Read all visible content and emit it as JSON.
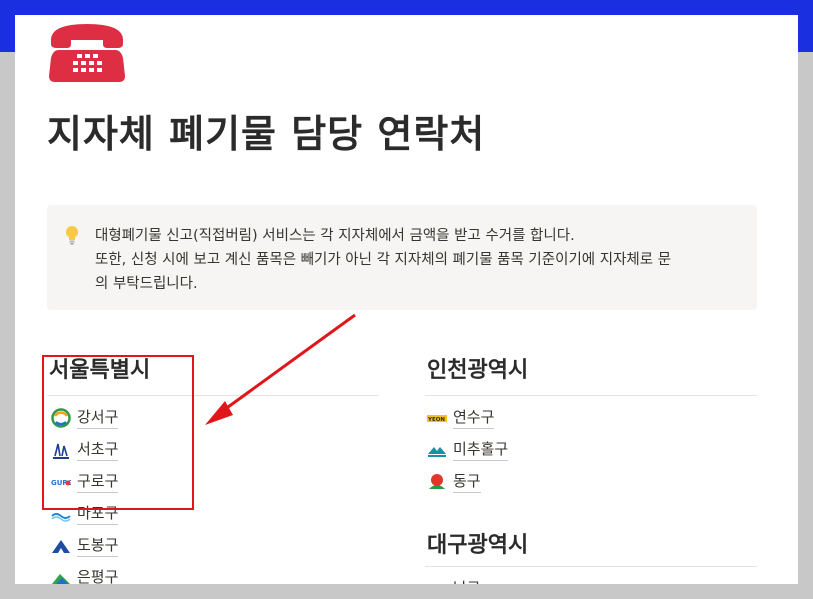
{
  "page": {
    "icon": "telephone-icon",
    "title": "지자체 폐기물 담당 연락처"
  },
  "callout": {
    "icon": "lightbulb-icon",
    "lines": [
      "대형폐기물 신고(직접버림) 서비스는 각 지자체에서 금액을 받고 수거를 합니다.",
      "또한, 신청 시에 보고 계신 품목은 빼기가 아닌 각 지자체의 폐기물 품목 기준이기에 지자체로 문",
      "의 부탁드립니다."
    ]
  },
  "sections": {
    "seoul": {
      "heading": "서울특별시",
      "items": [
        {
          "label": "강서구",
          "icon": "gangseo-logo-icon"
        },
        {
          "label": "서초구",
          "icon": "seocho-logo-icon"
        },
        {
          "label": "구로구",
          "icon": "guro-logo-icon"
        },
        {
          "label": "마포구",
          "icon": "mapo-logo-icon"
        },
        {
          "label": "도봉구",
          "icon": "dobong-logo-icon"
        },
        {
          "label": "은평구",
          "icon": "eunpyeong-logo-icon"
        }
      ]
    },
    "incheon": {
      "heading": "인천광역시",
      "items": [
        {
          "label": "연수구",
          "icon": "yeonsu-logo-icon"
        },
        {
          "label": "미추홀구",
          "icon": "michuhol-logo-icon"
        },
        {
          "label": "동구",
          "icon": "donggu-logo-icon"
        }
      ]
    },
    "daegu": {
      "heading": "대구광역시",
      "items": [
        {
          "label": "남구",
          "icon": "namgu-logo-icon"
        }
      ]
    }
  },
  "annotations": {
    "highlight_color": "#e0161b",
    "arrow_color": "#e0161b"
  }
}
